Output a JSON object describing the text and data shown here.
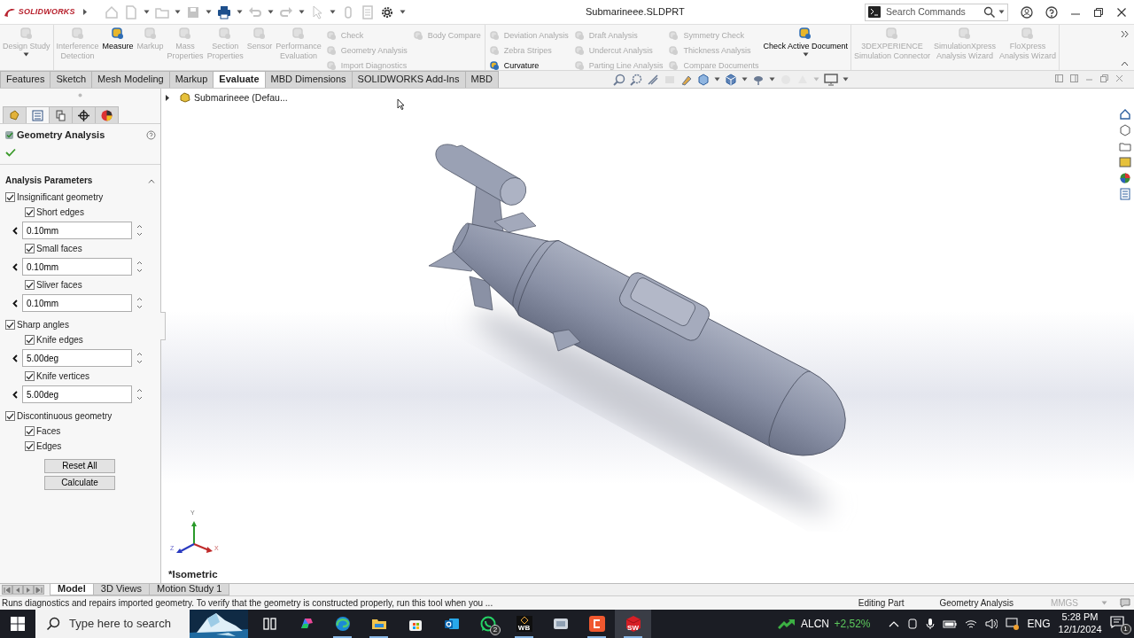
{
  "title_bar": {
    "logo": "SOLIDWORKS",
    "title": "Submarineee.SLDPRT",
    "search": {
      "placeholder": "Search Commands"
    }
  },
  "ribbon": {
    "groups": [
      {
        "items": [
          {
            "kind": "large",
            "label": "Design Study",
            "disabled": true,
            "dropdown": true
          }
        ]
      },
      {
        "items": [
          {
            "kind": "large",
            "label": "Interference\nDetection",
            "disabled": true
          },
          {
            "kind": "large",
            "label": "Measure",
            "disabled": false
          },
          {
            "kind": "large",
            "label": "Markup",
            "disabled": true
          },
          {
            "kind": "large",
            "label": "Mass\nProperties",
            "disabled": true
          },
          {
            "kind": "large",
            "label": "Section\nProperties",
            "disabled": true
          },
          {
            "kind": "large",
            "label": "Sensor",
            "disabled": true
          },
          {
            "kind": "large",
            "label": "Performance\nEvaluation",
            "disabled": true
          },
          {
            "kind": "column",
            "items": [
              {
                "label": "Check",
                "disabled": true
              },
              {
                "label": "Geometry Analysis",
                "disabled": true
              },
              {
                "label": "Import Diagnostics",
                "disabled": true
              }
            ]
          },
          {
            "kind": "column",
            "items": [
              {
                "label": "Body Compare",
                "disabled": true
              }
            ]
          }
        ]
      },
      {
        "items": [
          {
            "kind": "column",
            "items": [
              {
                "label": "Deviation Analysis",
                "disabled": true
              },
              {
                "label": "Zebra Stripes",
                "disabled": true
              },
              {
                "label": "Curvature",
                "disabled": false
              }
            ]
          },
          {
            "kind": "column",
            "items": [
              {
                "label": "Draft Analysis",
                "disabled": true
              },
              {
                "label": "Undercut Analysis",
                "disabled": true
              },
              {
                "label": "Parting Line Analysis",
                "disabled": true
              }
            ]
          },
          {
            "kind": "column",
            "items": [
              {
                "label": "Symmetry Check",
                "disabled": true
              },
              {
                "label": "Thickness Analysis",
                "disabled": true
              },
              {
                "label": "Compare Documents",
                "disabled": true
              }
            ]
          },
          {
            "kind": "large",
            "label": "Check Active Document",
            "disabled": false,
            "dropdown": true
          }
        ]
      },
      {
        "items": [
          {
            "kind": "large",
            "label": "3DEXPERIENCE\nSimulation Connector",
            "disabled": true
          },
          {
            "kind": "large",
            "label": "SimulationXpress\nAnalysis Wizard",
            "disabled": true
          },
          {
            "kind": "large",
            "label": "FloXpress\nAnalysis Wizard",
            "disabled": true
          }
        ]
      }
    ]
  },
  "tabs": [
    {
      "label": "Features",
      "selected": false
    },
    {
      "label": "Sketch",
      "selected": false
    },
    {
      "label": "Mesh Modeling",
      "selected": false
    },
    {
      "label": "Markup",
      "selected": false
    },
    {
      "label": "Evaluate",
      "selected": true
    },
    {
      "label": "MBD Dimensions",
      "selected": false
    },
    {
      "label": "SOLIDWORKS Add-Ins",
      "selected": false
    },
    {
      "label": "MBD",
      "selected": false
    }
  ],
  "property_manager": {
    "tabs": [
      {
        "kind": "feature",
        "selected": false
      },
      {
        "kind": "property",
        "selected": true
      },
      {
        "kind": "config",
        "selected": false
      },
      {
        "kind": "dimxpert",
        "selected": false
      },
      {
        "kind": "display",
        "selected": false
      }
    ],
    "title": "Geometry Analysis",
    "section": {
      "title": "Analysis Parameters",
      "expanded": true
    },
    "groups": [
      {
        "label": "Insignificant geometry",
        "checked": true,
        "children": [
          {
            "label": "Short edges",
            "checked": true,
            "value": "0.10mm"
          },
          {
            "label": "Small faces",
            "checked": true,
            "value": "0.10mm"
          },
          {
            "label": "Sliver faces",
            "checked": true,
            "value": "0.10mm"
          }
        ]
      },
      {
        "label": "Sharp angles",
        "checked": true,
        "children": [
          {
            "label": "Knife edges",
            "checked": true,
            "value": "5.00deg"
          },
          {
            "label": "Knife vertices",
            "checked": true,
            "value": "5.00deg"
          }
        ]
      },
      {
        "label": "Discontinuous geometry",
        "checked": true,
        "children": [
          {
            "label": "Faces",
            "checked": true
          },
          {
            "label": "Edges",
            "checked": true
          }
        ]
      }
    ],
    "buttons": [
      "Reset All",
      "Calculate"
    ]
  },
  "viewport": {
    "tree": {
      "label": "Submarineee (Defau...",
      "expanded": false
    },
    "triad": {
      "x": "X",
      "y": "Y",
      "z": "Z"
    },
    "view_name": "*Isometric"
  },
  "bottom_tabs": [
    {
      "label": "Model",
      "selected": true
    },
    {
      "label": "3D Views",
      "selected": false
    },
    {
      "label": "Motion Study 1",
      "selected": false
    }
  ],
  "status_bar": {
    "message": "Runs diagnostics and repairs imported geometry. To verify that the geometry is constructed properly, run this tool when you ...",
    "mode": "Editing Part",
    "tool": "Geometry Analysis",
    "units": "MMGS"
  },
  "taskbar": {
    "search": {
      "placeholder": "Type here to search"
    },
    "apps": [
      {
        "kind": "task-view",
        "running": false,
        "selected": false
      },
      {
        "kind": "copilot",
        "running": false,
        "selected": false
      },
      {
        "kind": "edge",
        "running": true,
        "selected": false
      },
      {
        "kind": "explorer",
        "running": true,
        "selected": false
      },
      {
        "kind": "store",
        "running": false,
        "selected": false
      },
      {
        "kind": "outlook",
        "running": false,
        "selected": false
      },
      {
        "kind": "whatsapp",
        "running": false,
        "selected": false,
        "badge": "2"
      },
      {
        "kind": "wb",
        "label": "WB",
        "running": true,
        "selected": false
      },
      {
        "kind": "app",
        "running": false,
        "selected": false
      },
      {
        "kind": "c-app",
        "running": true,
        "selected": false
      },
      {
        "kind": "sw",
        "label": "SW",
        "running": true,
        "selected": true
      }
    ],
    "stock": {
      "symbol": "ALCN",
      "change": "+2,52%"
    },
    "language": "ENG",
    "time": "5:28 PM",
    "date": "12/1/2024",
    "notifications": "1"
  }
}
